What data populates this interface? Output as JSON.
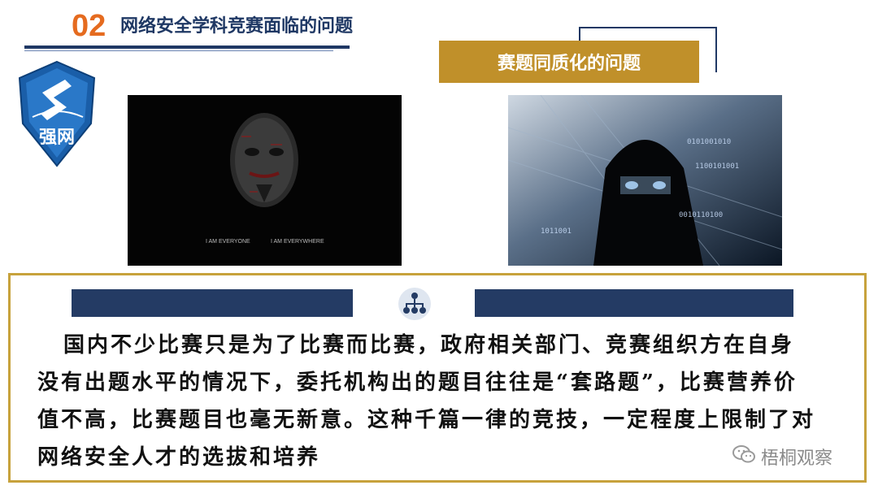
{
  "header": {
    "number": "02",
    "title": "网络安全学科竞赛面临的问题"
  },
  "label": {
    "text": "赛题同质化的问题"
  },
  "images": {
    "mask_caption_left": "I AM EVERYONE",
    "mask_caption_right": "I AM EVERYWHERE"
  },
  "logo": {
    "text": "强网"
  },
  "body": {
    "lines": [
      "国内不少比赛只是为了比赛而比赛，政府相关部门、竞赛组织方在自身",
      "没有出题水平的情况下，委托机构出的题目往往是“套路题”，比赛营养价",
      "值不高，比赛题目也毫无新意。这种千篇一律的竞技，一定程度上限制了对",
      "网络安全人才的选拔和培养"
    ]
  },
  "watermark": {
    "text": "梧桐观察"
  },
  "colors": {
    "accent_orange": "#e56b1f",
    "navy": "#1f3864",
    "gold": "#c0902a",
    "bar_navy": "#243b64"
  }
}
